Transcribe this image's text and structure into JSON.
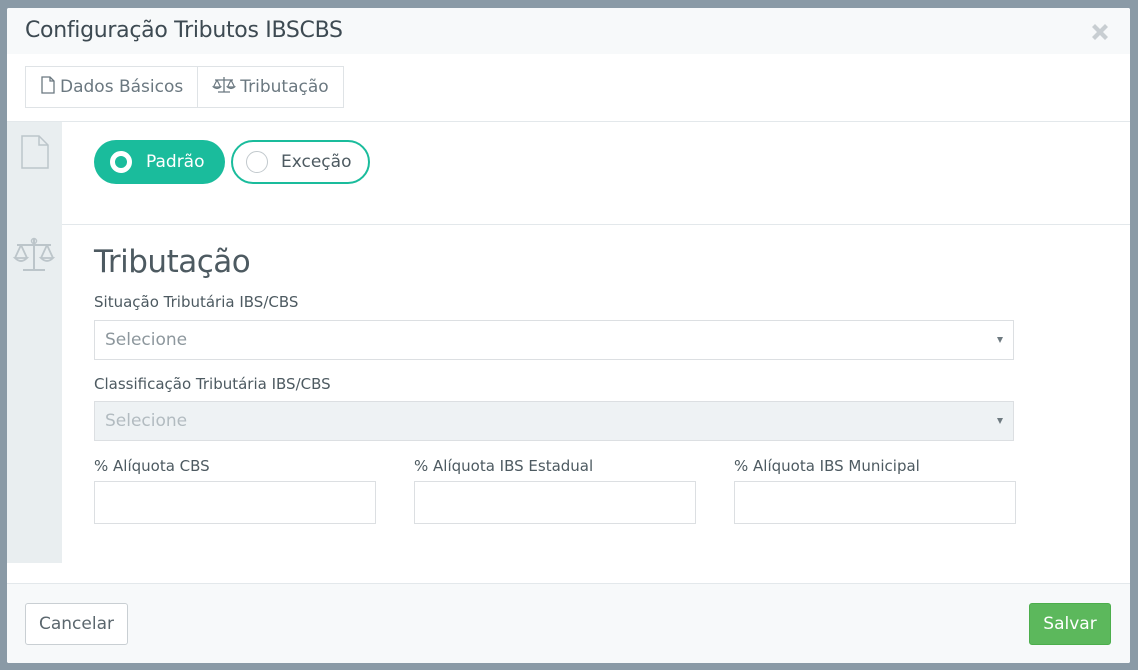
{
  "modal": {
    "title": "Configuração Tributos IBSCBS"
  },
  "tabs": [
    {
      "label": "Dados Básicos",
      "icon": "file-icon"
    },
    {
      "label": "Tributação",
      "icon": "balance-scale-icon"
    }
  ],
  "type_toggle": {
    "options": [
      {
        "label": "Padrão",
        "selected": true
      },
      {
        "label": "Exceção",
        "selected": false
      }
    ]
  },
  "section": {
    "title": "Tributação"
  },
  "fields": {
    "situacao": {
      "label": "Situação Tributária IBS/CBS",
      "placeholder": "Selecione",
      "enabled": true
    },
    "classificacao": {
      "label": "Classificação Tributária IBS/CBS",
      "placeholder": "Selecione",
      "enabled": false
    },
    "aliquota_cbs": {
      "label": "% Alíquota CBS",
      "value": ""
    },
    "aliquota_ibs_estadual": {
      "label": "% Alíquota IBS Estadual",
      "value": ""
    },
    "aliquota_ibs_municipal": {
      "label": "% Alíquota IBS Municipal",
      "value": ""
    }
  },
  "footer": {
    "cancel_label": "Cancelar",
    "save_label": "Salvar"
  },
  "colors": {
    "accent": "#1abc9c",
    "save": "#5cb85c"
  }
}
